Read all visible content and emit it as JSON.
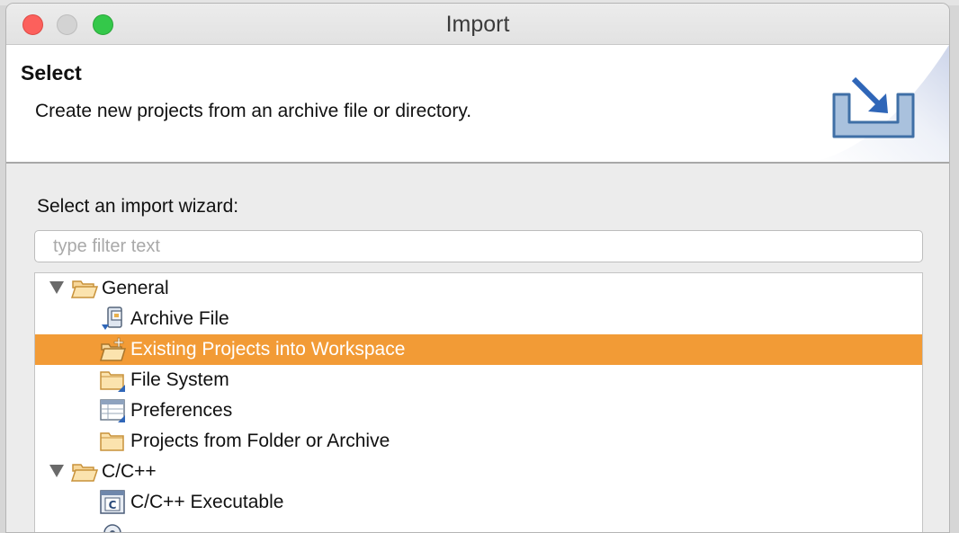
{
  "window": {
    "title": "Import"
  },
  "header": {
    "title": "Select",
    "description": "Create new projects from an archive file or directory."
  },
  "wizard": {
    "label": "Select an import wizard:",
    "filter_placeholder": "type filter text",
    "filter_value": ""
  },
  "tree": {
    "items": [
      {
        "label": "General",
        "icon": "folder-open-icon",
        "level": 0,
        "expanded": true
      },
      {
        "label": "Archive File",
        "icon": "archive-file-icon",
        "level": 1
      },
      {
        "label": "Existing Projects into Workspace",
        "icon": "existing-projects-icon",
        "level": 1,
        "selected": true
      },
      {
        "label": "File System",
        "icon": "folder-icon",
        "level": 1
      },
      {
        "label": "Preferences",
        "icon": "preferences-icon",
        "level": 1
      },
      {
        "label": "Projects from Folder or Archive",
        "icon": "folder-icon",
        "level": 1
      },
      {
        "label": "C/C++",
        "icon": "folder-open-icon",
        "level": 0,
        "expanded": true
      },
      {
        "label": "C/C++ Executable",
        "icon": "c-executable-icon",
        "level": 1
      }
    ]
  },
  "colors": {
    "selection": "#f29b36",
    "close": "#fc605c",
    "maximize": "#34c84a"
  }
}
